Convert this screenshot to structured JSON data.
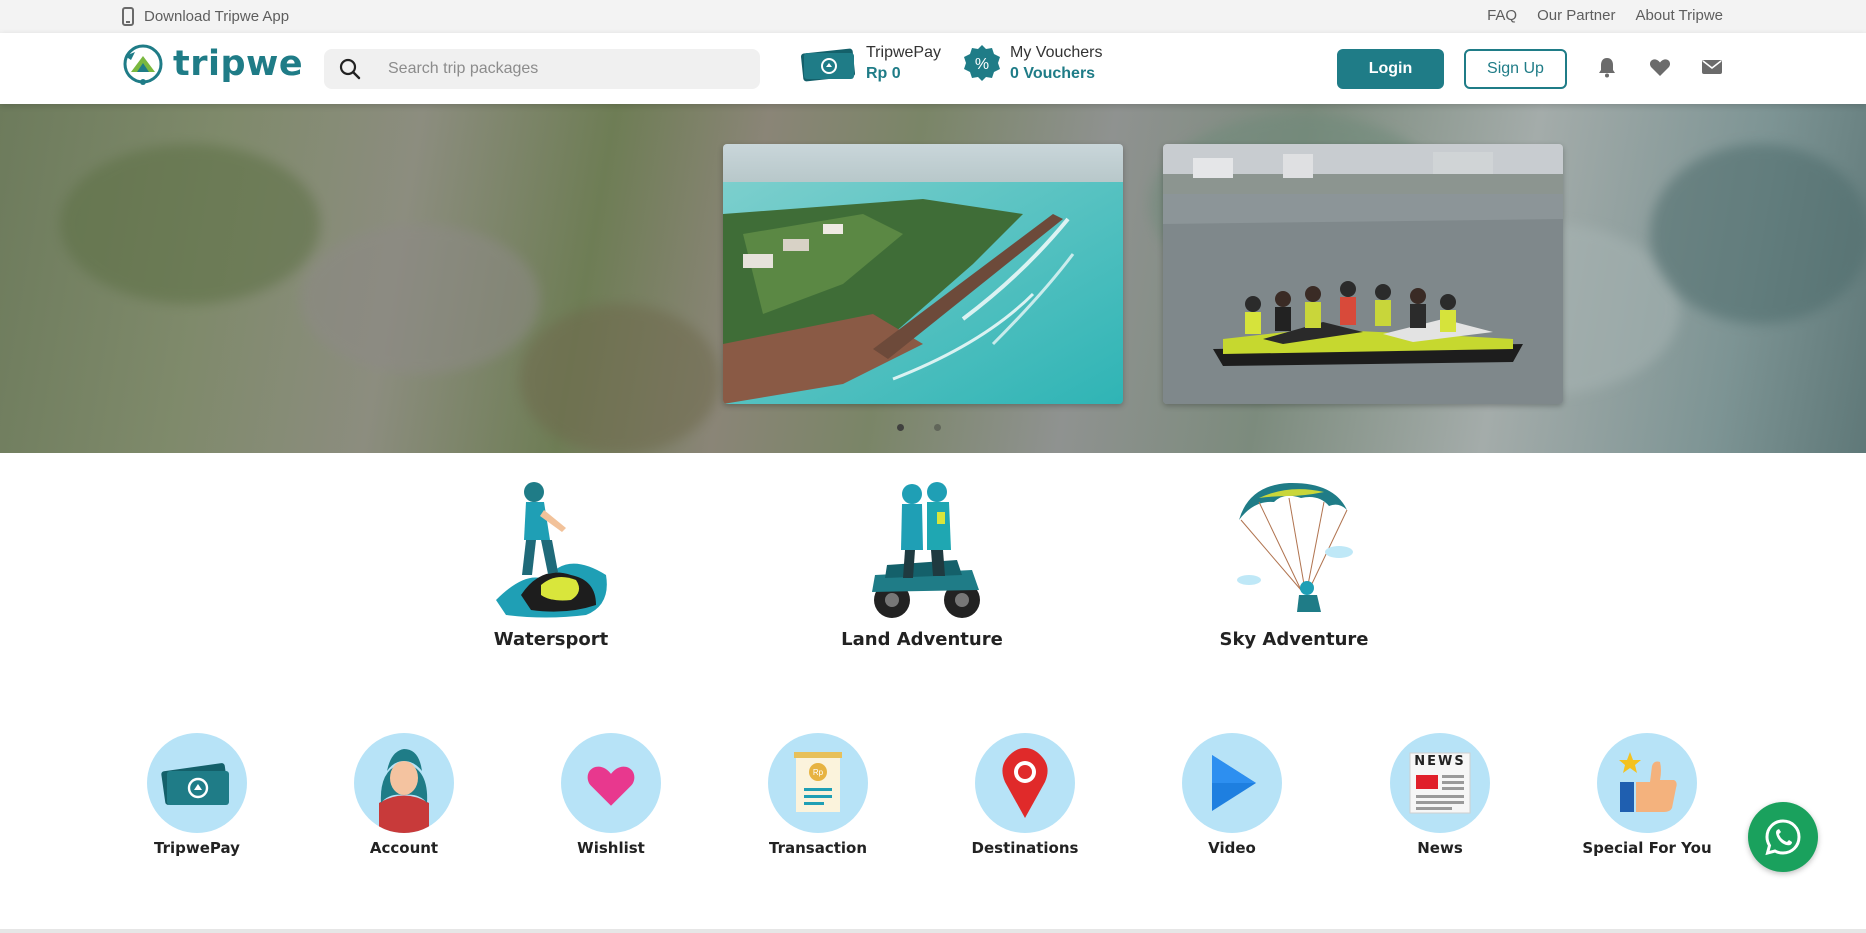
{
  "topbar": {
    "download_app": "Download Tripwe App",
    "links": [
      "FAQ",
      "Our Partner",
      "About Tripwe"
    ]
  },
  "header": {
    "logo_text": "tripwe",
    "search_placeholder": "Search trip packages",
    "wallet": {
      "label": "TripwePay",
      "value": "Rp 0"
    },
    "vouchers": {
      "label": "My Vouchers",
      "value": "0 Vouchers"
    },
    "login_label": "Login",
    "signup_label": "Sign Up",
    "icons": [
      "bell-icon",
      "heart-icon",
      "mail-icon"
    ]
  },
  "hero": {
    "slides": [
      "aerial-island-jetski-photo",
      "group-jetski-photo"
    ],
    "active_slide": 1,
    "slide_count": 2
  },
  "categories": [
    {
      "label": "Watersport",
      "icon": "jetski-rider-illustration"
    },
    {
      "label": "Land Adventure",
      "icon": "atv-riders-illustration"
    },
    {
      "label": "Sky Adventure",
      "icon": "paraglider-illustration"
    }
  ],
  "menu": [
    {
      "label": "TripwePay",
      "icon": "wallet-cash-icon"
    },
    {
      "label": "Account",
      "icon": "user-avatar-icon"
    },
    {
      "label": "Wishlist",
      "icon": "heart-icon"
    },
    {
      "label": "Transaction",
      "icon": "receipt-icon"
    },
    {
      "label": "Destinations",
      "icon": "map-pin-icon"
    },
    {
      "label": "Video",
      "icon": "play-icon"
    },
    {
      "label": "News",
      "icon": "newspaper-icon",
      "badge_text": "NEWS"
    },
    {
      "label": "Special For You",
      "icon": "thumbs-up-star-icon"
    }
  ],
  "colors": {
    "brand": "#1f7c87",
    "menu_circle": "#b7e3f7",
    "whatsapp": "#1aa15d",
    "topbar_bg": "#f3f3f3"
  },
  "floating": {
    "whatsapp": "whatsapp-icon"
  }
}
